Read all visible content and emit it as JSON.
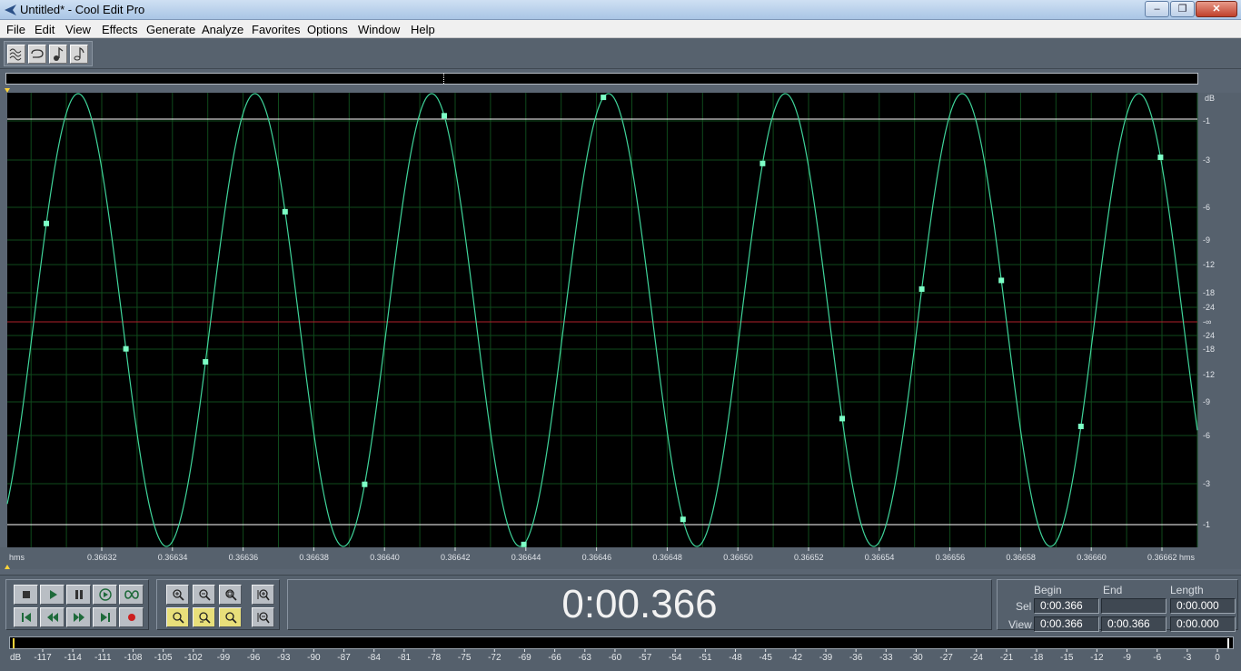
{
  "window": {
    "title": "Untitled* - Cool Edit Pro",
    "minimize_label": "‒",
    "maximize_label": "❐",
    "close_label": "✕"
  },
  "menu": {
    "items": [
      "File",
      "Edit",
      "View",
      "Effects",
      "Generate",
      "Analyze",
      "Favorites",
      "Options",
      "Window",
      "Help"
    ]
  },
  "toolbar": {
    "buttons": [
      "waveform-view-icon",
      "loop-icon",
      "midi-icon",
      "note-icon"
    ]
  },
  "waveform": {
    "time_unit_left": "hms",
    "time_unit_right": "hms",
    "time_ticks": [
      "0.36632",
      "0.36634",
      "0.36636",
      "0.36638",
      "0.36640",
      "0.36642",
      "0.36644",
      "0.36646",
      "0.36648",
      "0.36650",
      "0.36652",
      "0.36654",
      "0.36656",
      "0.36658",
      "0.36660",
      "0.36662"
    ],
    "db_unit": "dB",
    "db_labels_top": [
      "-1",
      "-3",
      "-6",
      "-9",
      "-12",
      "-18",
      "-24"
    ],
    "db_center": "-∞",
    "db_labels_bottom": [
      "-24",
      "-18",
      "-12",
      "-9",
      "-6",
      "-3",
      "-1"
    ],
    "wave_color": "#3fd49a",
    "sample_color": "#7dffc6",
    "center_line_color": "#b0202a",
    "clip_line_color": "#ffffff",
    "grid_color": "#0f4a1c"
  },
  "transport": {
    "buttons_row1": [
      "stop-icon",
      "play-icon",
      "pause-icon",
      "play-to-end-icon",
      "loop-play-icon"
    ],
    "buttons_row2": [
      "go-to-start-icon",
      "rewind-icon",
      "fast-forward-icon",
      "go-to-end-icon",
      "record-icon"
    ],
    "zoom_row1": [
      "zoom-in-horizontal-icon",
      "zoom-out-horizontal-icon",
      "zoom-full-icon",
      "zoom-in-vertical-icon"
    ],
    "zoom_row2": [
      "zoom-selection-icon",
      "zoom-left-icon",
      "zoom-right-icon",
      "zoom-out-vertical-icon"
    ],
    "time": "0:00.366"
  },
  "selection": {
    "begin_label": "Begin",
    "end_label": "End",
    "length_label": "Length",
    "sel_label": "Sel",
    "view_label": "View",
    "sel_begin": "0:00.366",
    "sel_end": "",
    "sel_length": "0:00.000",
    "view_begin": "0:00.366",
    "view_end": "0:00.366",
    "view_length": "0:00.000"
  },
  "meter": {
    "unit": "dB",
    "labels": [
      "-117",
      "-114",
      "-111",
      "-108",
      "-105",
      "-102",
      "-99",
      "-96",
      "-93",
      "-90",
      "-87",
      "-84",
      "-81",
      "-78",
      "-75",
      "-72",
      "-69",
      "-66",
      "-63",
      "-60",
      "-57",
      "-54",
      "-51",
      "-48",
      "-45",
      "-42",
      "-39",
      "-36",
      "-33",
      "-30",
      "-27",
      "-24",
      "-21",
      "-18",
      "-15",
      "-12",
      "-9",
      "-6",
      "-3",
      "0"
    ]
  }
}
